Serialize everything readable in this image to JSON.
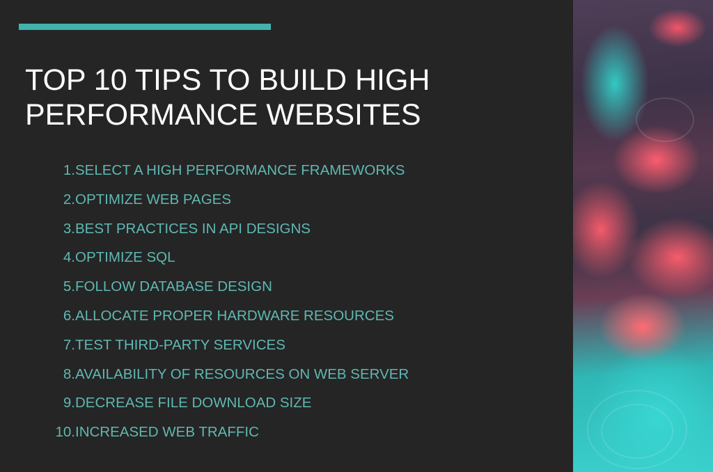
{
  "slide": {
    "title_lines": [
      "TOP 10 TIPS TO BUILD HIGH",
      "PERFORMANCE WEBSITES"
    ],
    "tips": [
      {
        "num": "1.",
        "text": "SELECT A HIGH PERFORMANCE FRAMEWORKS"
      },
      {
        "num": "2.",
        "text": "OPTIMIZE WEB PAGES"
      },
      {
        "num": "3.",
        "text": "BEST PRACTICES IN API DESIGNS"
      },
      {
        "num": "4.",
        "text": "OPTIMIZE SQL"
      },
      {
        "num": "5.",
        "text": "FOLLOW DATABASE DESIGN"
      },
      {
        "num": "6.",
        "text": "ALLOCATE PROPER HARDWARE RESOURCES"
      },
      {
        "num": "7.",
        "text": "TEST THIRD-PARTY SERVICES"
      },
      {
        "num": "8.",
        "text": "AVAILABILITY OF RESOURCES ON WEB SERVER"
      },
      {
        "num": "9.",
        "text": "DECREASE FILE DOWNLOAD SIZE"
      },
      {
        "num": "10.",
        "text": "INCREASED WEB TRAFFIC"
      }
    ]
  },
  "colors": {
    "background": "#252525",
    "accent": "#41b3ad",
    "title": "#ffffff",
    "list_text": "#5fb8b2"
  }
}
